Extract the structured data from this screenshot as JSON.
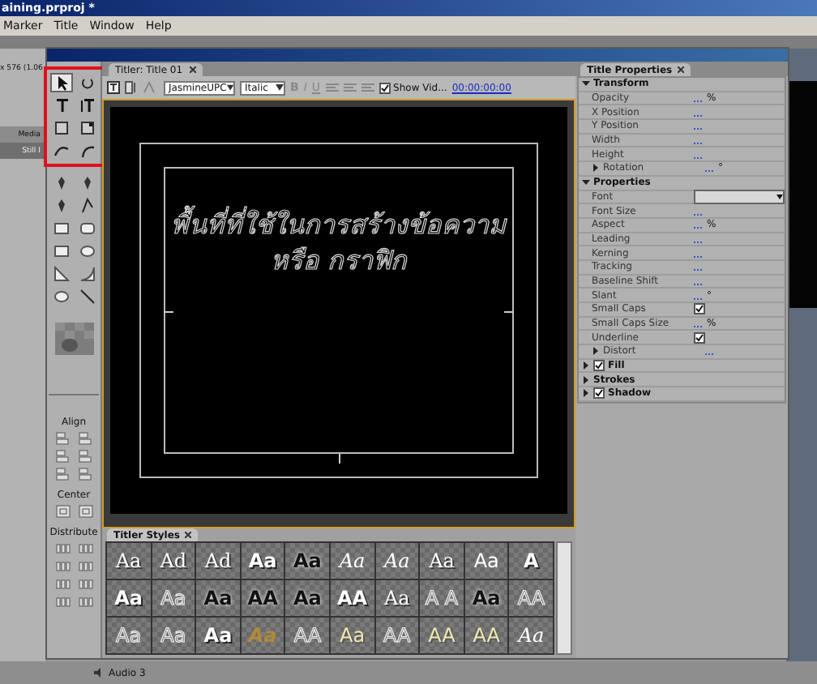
{
  "app": {
    "title": "aining.prproj *",
    "menu": [
      "Marker",
      "Title",
      "Window",
      "Help"
    ],
    "frame_info": "x 576 (1.06",
    "media_tab": "Media",
    "still_label": "Still I",
    "audio_track": "Audio 3"
  },
  "titler": {
    "tab": "Titler: Title 01",
    "toolbar": {
      "font": "JasmineUPC",
      "style": "Italic",
      "bold": "B",
      "italic": "I",
      "underline": "U",
      "show_video": {
        "label": "Show Vid...",
        "checked": true
      },
      "timecode": "00:00:00:00"
    },
    "canvas": {
      "lines": [
        "พื้นที่ที่ใช้ในการสร้างข้อความ",
        "หรือ กราฟิก"
      ]
    },
    "tool_groups": [
      {
        "highlighted": true,
        "tools": [
          {
            "kind": "arrow",
            "selected": true
          },
          {
            "kind": "rotate",
            "selected": false
          },
          {
            "kind": "type",
            "selected": false
          },
          {
            "kind": "vtype",
            "selected": false
          },
          {
            "kind": "area",
            "selected": false
          },
          {
            "kind": "varea",
            "selected": false
          },
          {
            "kind": "path",
            "selected": false
          },
          {
            "kind": "vpath",
            "selected": false
          }
        ]
      },
      {
        "highlighted": false,
        "tools": [
          {
            "kind": "pen",
            "selected": false
          },
          {
            "kind": "pen",
            "selected": false
          },
          {
            "kind": "pen",
            "selected": false
          },
          {
            "kind": "convert",
            "selected": false
          },
          {
            "kind": "rect",
            "selected": false
          },
          {
            "kind": "roundrect",
            "selected": false
          },
          {
            "kind": "rect",
            "selected": false
          },
          {
            "kind": "ellipse",
            "selected": false
          },
          {
            "kind": "wedge",
            "selected": false
          },
          {
            "kind": "arc",
            "selected": false
          },
          {
            "kind": "ellipse",
            "selected": false
          },
          {
            "kind": "line",
            "selected": false
          }
        ]
      }
    ],
    "align_sections": [
      {
        "label": "Align",
        "buttons": [
          {
            "kind": "align"
          },
          {
            "kind": "align"
          },
          {
            "kind": "align"
          },
          {
            "kind": "align"
          },
          {
            "kind": "align"
          },
          {
            "kind": "align"
          }
        ]
      },
      {
        "label": "Center",
        "buttons": [
          {
            "kind": "center"
          },
          {
            "kind": "center"
          }
        ]
      },
      {
        "label": "Distribute",
        "buttons": [
          {
            "kind": "distribute"
          },
          {
            "kind": "distribute"
          },
          {
            "kind": "distribute"
          },
          {
            "kind": "distribute"
          },
          {
            "kind": "distribute"
          },
          {
            "kind": "distribute"
          },
          {
            "kind": "distribute"
          },
          {
            "kind": "distribute"
          }
        ]
      }
    ],
    "styles_panel": {
      "title": "Titler Styles",
      "swatches": [
        {
          "text": "Aa",
          "kind": "serif"
        },
        {
          "text": "Ad",
          "kind": "serif"
        },
        {
          "text": "Ad",
          "kind": "serif"
        },
        {
          "text": "Aa",
          "kind": "bold"
        },
        {
          "text": "Aa",
          "kind": "dark"
        },
        {
          "text": "Aa",
          "kind": "script"
        },
        {
          "text": "Aa",
          "kind": "script"
        },
        {
          "text": "Aa",
          "kind": "serif"
        },
        {
          "text": "Aa",
          "kind": "plain"
        },
        {
          "text": "A",
          "kind": "bold"
        },
        {
          "text": "Aa",
          "kind": "bold"
        },
        {
          "text": "Aa",
          "kind": "outline"
        },
        {
          "text": "Aa",
          "kind": "dark"
        },
        {
          "text": "AA",
          "kind": "dark"
        },
        {
          "text": "Aa",
          "kind": "dark"
        },
        {
          "text": "AA",
          "kind": "bold"
        },
        {
          "text": "Aa",
          "kind": "serif"
        },
        {
          "text": "A A",
          "kind": "outline"
        },
        {
          "text": "Aa",
          "kind": "dark"
        },
        {
          "text": "AA",
          "kind": "outline"
        },
        {
          "text": "Aa",
          "kind": "outline"
        },
        {
          "text": "Aa",
          "kind": "outline"
        },
        {
          "text": "Aa",
          "kind": "bold"
        },
        {
          "text": "Aa",
          "kind": "gold"
        },
        {
          "text": "AA",
          "kind": "outline"
        },
        {
          "text": "Aa",
          "kind": "cream"
        },
        {
          "text": "AA",
          "kind": "outline"
        },
        {
          "text": "AA",
          "kind": "cream"
        },
        {
          "text": "AA",
          "kind": "cream"
        },
        {
          "text": "Aa",
          "kind": "script"
        }
      ]
    },
    "properties": {
      "title": "Title Properties",
      "rows": [
        {
          "kind": "section",
          "label": "Transform",
          "expanded": true
        },
        {
          "kind": "value",
          "label": "Opacity",
          "unit": "%"
        },
        {
          "kind": "value",
          "label": "X Position"
        },
        {
          "kind": "value",
          "label": "Y Position"
        },
        {
          "kind": "value",
          "label": "Width"
        },
        {
          "kind": "value",
          "label": "Height"
        },
        {
          "kind": "group",
          "label": "Rotation",
          "unit": "°",
          "expanded": false
        },
        {
          "kind": "section",
          "label": "Properties",
          "expanded": true
        },
        {
          "kind": "dropdown",
          "label": "Font"
        },
        {
          "kind": "value",
          "label": "Font Size"
        },
        {
          "kind": "value",
          "label": "Aspect",
          "unit": "%"
        },
        {
          "kind": "value",
          "label": "Leading"
        },
        {
          "kind": "value",
          "label": "Kerning"
        },
        {
          "kind": "value",
          "label": "Tracking"
        },
        {
          "kind": "value",
          "label": "Baseline Shift"
        },
        {
          "kind": "value",
          "label": "Slant",
          "unit": "°"
        },
        {
          "kind": "checkbox",
          "label": "Small Caps",
          "checked": true
        },
        {
          "kind": "value",
          "label": "Small Caps Size",
          "unit": "%"
        },
        {
          "kind": "checkbox",
          "label": "Underline",
          "checked": true
        },
        {
          "kind": "group",
          "label": "Distort",
          "expanded": false
        },
        {
          "kind": "section_check",
          "label": "Fill",
          "expanded": false,
          "checked": true
        },
        {
          "kind": "section",
          "label": "Strokes",
          "expanded": false
        },
        {
          "kind": "section_check",
          "label": "Shadow",
          "expanded": false,
          "checked": true
        }
      ]
    }
  }
}
